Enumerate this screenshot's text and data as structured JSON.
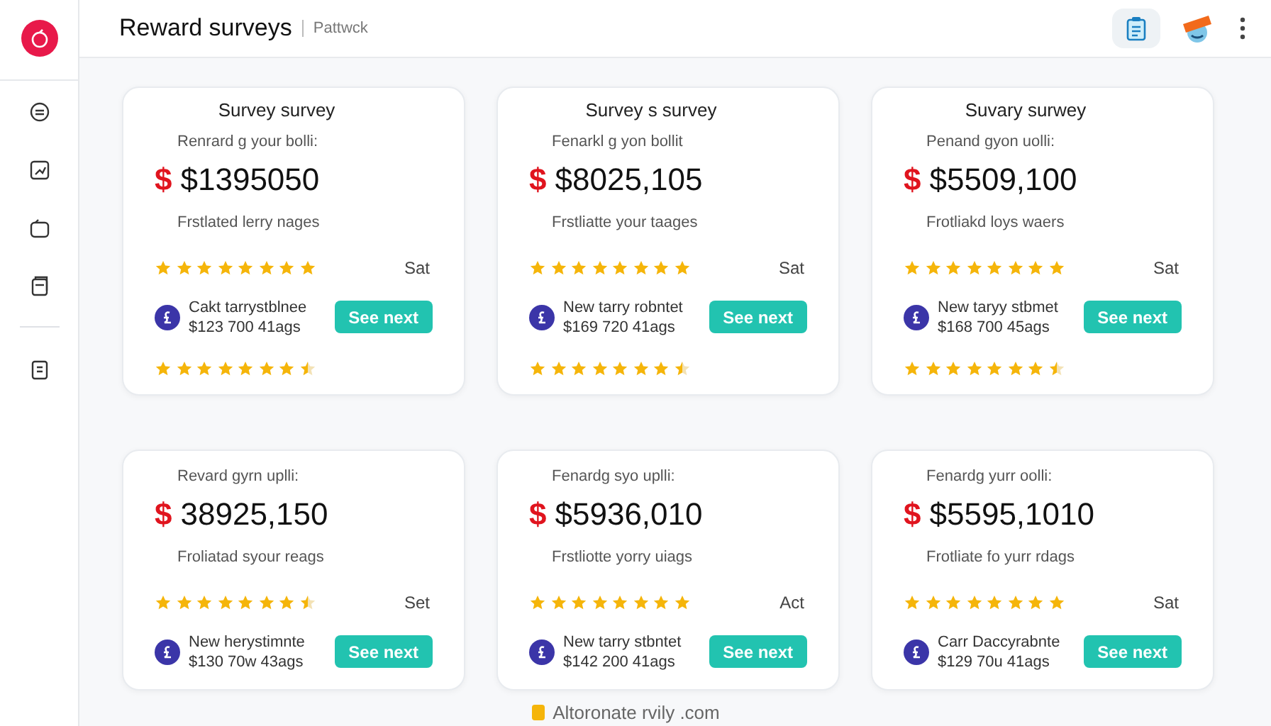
{
  "header": {
    "title": "Reward surveys",
    "subtitle": "Pattwck"
  },
  "cards": [
    {
      "title": "Survey survey",
      "subtitle": "Renrard g your bolli:",
      "currency": "$",
      "amount": "$1395050",
      "note": "Frstlated lerry nages",
      "stars": 8,
      "stars_label": "Sat",
      "offer_name": "Cakt tarrystblnee",
      "offer_detail": "$123 700 41ags",
      "button": "See next",
      "extra_rating": {
        "stars": 7.5
      }
    },
    {
      "title": "Survey s survey",
      "subtitle": "Fenarkl g yon bollit",
      "currency": "$",
      "amount": "$8025,105",
      "note": "Frstliatte your taages",
      "stars": 8,
      "stars_label": "Sat",
      "offer_name": "New tarry robntet",
      "offer_detail": "$169 720 41ags",
      "button": "See next",
      "extra_rating": {
        "stars": 7.5
      }
    },
    {
      "title": "Suvary surwey",
      "subtitle": "Penand gyon uolli:",
      "currency": "$",
      "amount": "$5509,100",
      "note": "Frotliakd loys waers",
      "stars": 8,
      "stars_label": "Sat",
      "offer_name": "New taryy stbmet",
      "offer_detail": "$168 700 45ags",
      "button": "See next",
      "extra_rating": {
        "stars": 7.5
      }
    },
    {
      "subtitle": "Revard gyrn uplli:",
      "currency": "$",
      "amount": "38925,150",
      "note": "Froliatad syour reags",
      "stars": 7.5,
      "stars_label": "Set",
      "offer_name": "New herystimnte",
      "offer_detail": "$130 70w 43ags",
      "button": "See next"
    },
    {
      "subtitle": "Fenardg syo uplli:",
      "currency": "$",
      "amount": "$5936,010",
      "note": "Frstliotte yorry uiags",
      "stars": 8,
      "stars_label": "Act",
      "offer_name": "New tarry stbntet",
      "offer_detail": "$142 200 41ags",
      "button": "See next"
    },
    {
      "subtitle": "Fenardg yurr oolli:",
      "currency": "$",
      "amount": "$5595,1010",
      "note": "Frotliate fo yurr rdags",
      "stars": 8,
      "stars_label": "Sat",
      "offer_name": "Carr Daccyrabnte",
      "offer_detail": "$129 70u 41ags",
      "button": "See next"
    }
  ],
  "footer": {
    "text": "Altoronate rvily .com"
  }
}
